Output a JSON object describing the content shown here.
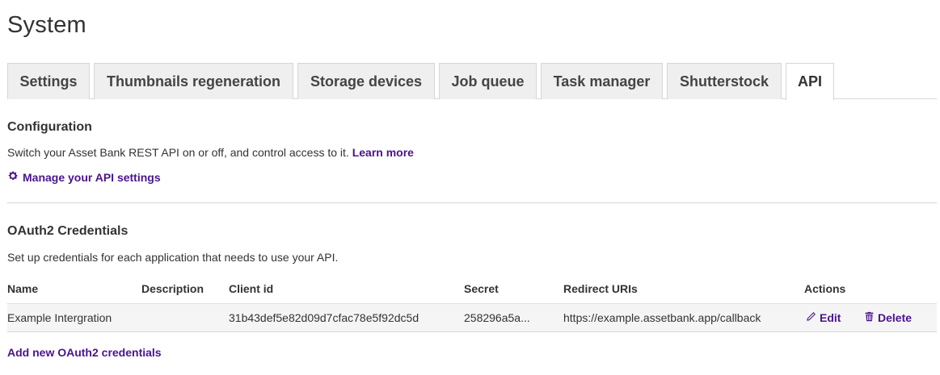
{
  "page": {
    "title": "System"
  },
  "tabs": [
    {
      "label": "Settings"
    },
    {
      "label": "Thumbnails regeneration"
    },
    {
      "label": "Storage devices"
    },
    {
      "label": "Job queue"
    },
    {
      "label": "Task manager"
    },
    {
      "label": "Shutterstock"
    },
    {
      "label": "API",
      "active": true
    }
  ],
  "configuration": {
    "title": "Configuration",
    "description": "Switch your Asset Bank REST API on or off, and control access to it.",
    "learn_more": "Learn more",
    "manage_label": "Manage your API settings",
    "manage_icon": "gear-icon"
  },
  "oauth": {
    "title": "OAuth2 Credentials",
    "description": "Set up credentials for each application that needs to use your API.",
    "columns": {
      "name": "Name",
      "description": "Description",
      "client_id": "Client id",
      "secret": "Secret",
      "redirect_uris": "Redirect URIs",
      "actions": "Actions"
    },
    "rows": [
      {
        "name": "Example Intergration",
        "description": "",
        "client_id": "31b43def5e82d09d7cfac78e5f92dc5d",
        "secret": "258296a5a...",
        "redirect_uris": "https://example.assetbank.app/callback",
        "edit_label": "Edit",
        "delete_label": "Delete"
      }
    ],
    "add_label": "Add new OAuth2 credentials"
  },
  "colors": {
    "link": "#4a148c",
    "tab_bg": "#efefef",
    "row_bg": "#f5f5f5"
  }
}
